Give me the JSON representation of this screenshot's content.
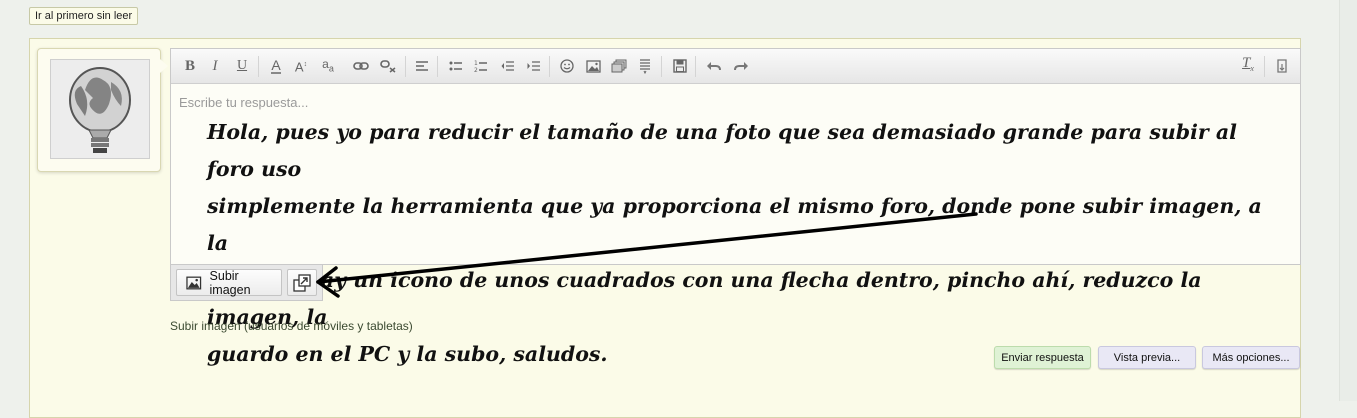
{
  "top": {
    "first_unread_label": "Ir al primero sin leer"
  },
  "editor": {
    "placeholder": "Escribe tu respuesta...",
    "message_lines": [
      "Hola, pues yo para reducir el tamaño de una foto que sea demasiado grande para subir al foro uso",
      "simplemente la herramienta que  ya proporciona el mismo foro, donde pone subir imagen, a la",
      "derecha hay un icono de unos cuadrados con una flecha dentro, pincho ahí, reduzco la imagen, la",
      "guardo en el PC y la subo, saludos."
    ],
    "toolbar_icons": [
      "bold-icon",
      "italic-icon",
      "underline-icon",
      "text-color-icon",
      "font-size-icon",
      "font-case-icon",
      "link-icon",
      "unlink-icon",
      "align-icon",
      "bullet-list-icon",
      "numbered-list-icon",
      "outdent-icon",
      "indent-icon",
      "smiley-icon",
      "image-icon",
      "media-icon",
      "quote-icon",
      "save-draft-icon",
      "undo-icon",
      "redo-icon",
      "remove-format-icon",
      "toggle-source-icon"
    ]
  },
  "attach": {
    "upload_label": "Subir imagen",
    "mobile_upload_link": "Subir imagen (usuarios de móviles y tabletas)"
  },
  "actions": {
    "send_label": "Enviar respuesta",
    "preview_label": "Vista previa...",
    "more_label": "Más opciones..."
  },
  "colors": {
    "panel_bg": "#fbfbe8",
    "send_bg": "#dff2d5",
    "secondary_btn_bg": "#e9e8f5",
    "link_color": "#3b4a31"
  }
}
